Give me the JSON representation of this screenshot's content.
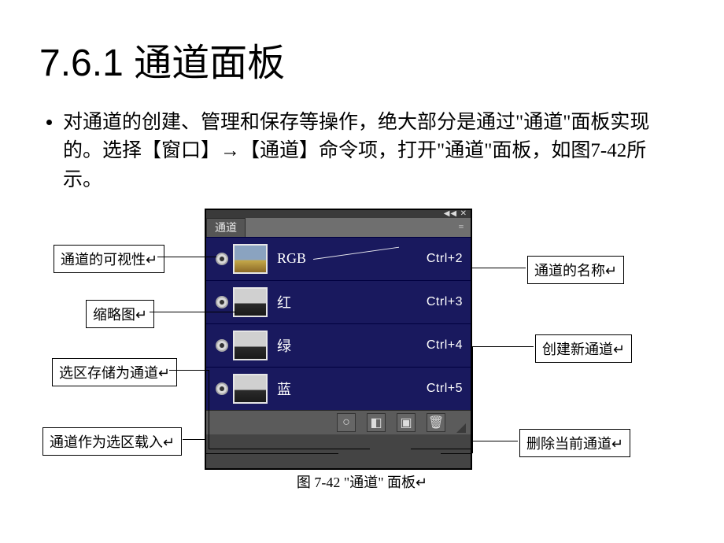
{
  "heading": "7.6.1 通道面板",
  "bullet": "对通道的创建、管理和保存等操作，绝大部分是通过\"通道\"面板实现的。选择【窗口】→【通道】命令项，打开\"通道\"面板，如图7-42所示。",
  "panel": {
    "tab_label": "通道",
    "channels": [
      {
        "name": "RGB",
        "shortcut": "Ctrl+2",
        "thumb": "color"
      },
      {
        "name": "红",
        "shortcut": "Ctrl+3",
        "thumb": "bw"
      },
      {
        "name": "绿",
        "shortcut": "Ctrl+4",
        "thumb": "bw"
      },
      {
        "name": "蓝",
        "shortcut": "Ctrl+5",
        "thumb": "bw"
      }
    ],
    "footer_icons": [
      "○",
      "◧",
      "▣",
      "🗑"
    ]
  },
  "callouts": {
    "visibility": "通道的可视性↵",
    "thumbnail": "缩略图↵",
    "save_selection": "选区存储为通道↵",
    "load_as_selection": "通道作为选区载入↵",
    "channel_name": "通道的名称↵",
    "create_new": "创建新通道↵",
    "delete_current": "删除当前通道↵"
  },
  "caption": "图 7-42  \"通道\" 面板↵"
}
